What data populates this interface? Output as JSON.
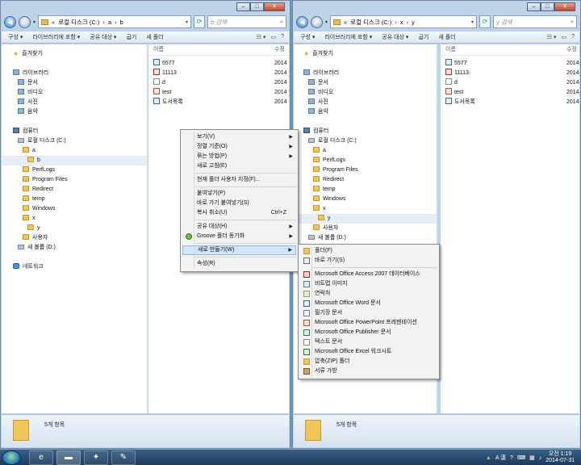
{
  "left_window": {
    "path": [
      "«",
      "로컬 디스크 (C:)",
      "a",
      "b"
    ],
    "search_placeholder": "b 검색",
    "controls": {
      "min": "–",
      "max": "□",
      "close": "✕"
    },
    "commands": [
      "구성 ▾",
      "라이브러리에 포함 ▾",
      "공유 대상 ▾",
      "굽기",
      "새 폴더"
    ],
    "nav": [
      "즐겨찾기",
      "라이브러리",
      "문서",
      "비디오",
      "사진",
      "음악",
      "컴퓨터",
      "로컬 디스크 (C:)",
      "a",
      "b",
      "PerfLogs",
      "Program Files",
      "Redirect",
      "temp",
      "Windows",
      "x",
      "y",
      "사용자",
      "새 볼륨 (D:)",
      "네트워크"
    ],
    "col_name": "이름",
    "col_date": "수정",
    "files": [
      {
        "name": "5577",
        "date": "2014",
        "kind": "doc"
      },
      {
        "name": "11113",
        "date": "2014",
        "kind": "pdf"
      },
      {
        "name": "d",
        "date": "2014",
        "kind": "txt"
      },
      {
        "name": "test",
        "date": "2014",
        "kind": "bin"
      },
      {
        "name": "도서목록",
        "date": "2014",
        "kind": "doc"
      }
    ],
    "status": "5개 항목"
  },
  "right_window": {
    "path": [
      "«",
      "로컬 디스크 (C:)",
      "x",
      "y"
    ],
    "search_placeholder": "y 검색",
    "controls": {
      "min": "–",
      "max": "□",
      "close": "✕"
    },
    "commands": [
      "구성 ▾",
      "라이브러리에 포함 ▾",
      "공유 대상 ▾",
      "굽기",
      "새 폴더"
    ],
    "nav": [
      "즐겨찾기",
      "라이브러리",
      "문서",
      "비디오",
      "사진",
      "음악",
      "컴퓨터",
      "로컬 디스크 (C:)",
      "a",
      "PerfLogs",
      "Program Files",
      "Redirect",
      "temp",
      "Windows",
      "x",
      "y",
      "사용자",
      "새 볼륨 (D:)"
    ],
    "col_name": "이름",
    "col_date": "수정",
    "files": [
      {
        "name": "5577",
        "date": "2014",
        "kind": "doc"
      },
      {
        "name": "11113",
        "date": "2014",
        "kind": "pdf"
      },
      {
        "name": "d",
        "date": "2014",
        "kind": "txt"
      },
      {
        "name": "test",
        "date": "2014",
        "kind": "bin"
      },
      {
        "name": "도서목록",
        "date": "2014",
        "kind": "doc"
      }
    ],
    "status": "5개 항목"
  },
  "context_menu": {
    "items": [
      "보기(V)",
      "정렬 기준(O)",
      "묶는 방법(P)",
      "새로 고침(E)",
      "현재 폴더 사용자 지정(F)...",
      "붙여넣기(P)",
      "바로 가기 붙여넣기(S)",
      "복사 취소(U)",
      "공유 대상(H)",
      "Groove 폴더 동기화",
      "새로 만들기(W)",
      "속성(R)"
    ],
    "shortcut": "Ctrl+Z"
  },
  "submenu": {
    "items": [
      "폴더(F)",
      "바로 가기(S)",
      "Microsoft Office Access 2007 데이터베이스",
      "비트맵 이미지",
      "연락처",
      "Microsoft Office Word 문서",
      "필기장 문서",
      "Microsoft Office PowerPoint 프레젠테이션",
      "Microsoft Office Publisher 문서",
      "텍스트 문서",
      "Microsoft Office Excel 워크시트",
      "압축(ZIP) 폴더",
      "서류 가방"
    ]
  },
  "taskbar": {
    "tray_lang": "A 漢",
    "time": "오전 1:19",
    "date": "2014-07-31"
  }
}
